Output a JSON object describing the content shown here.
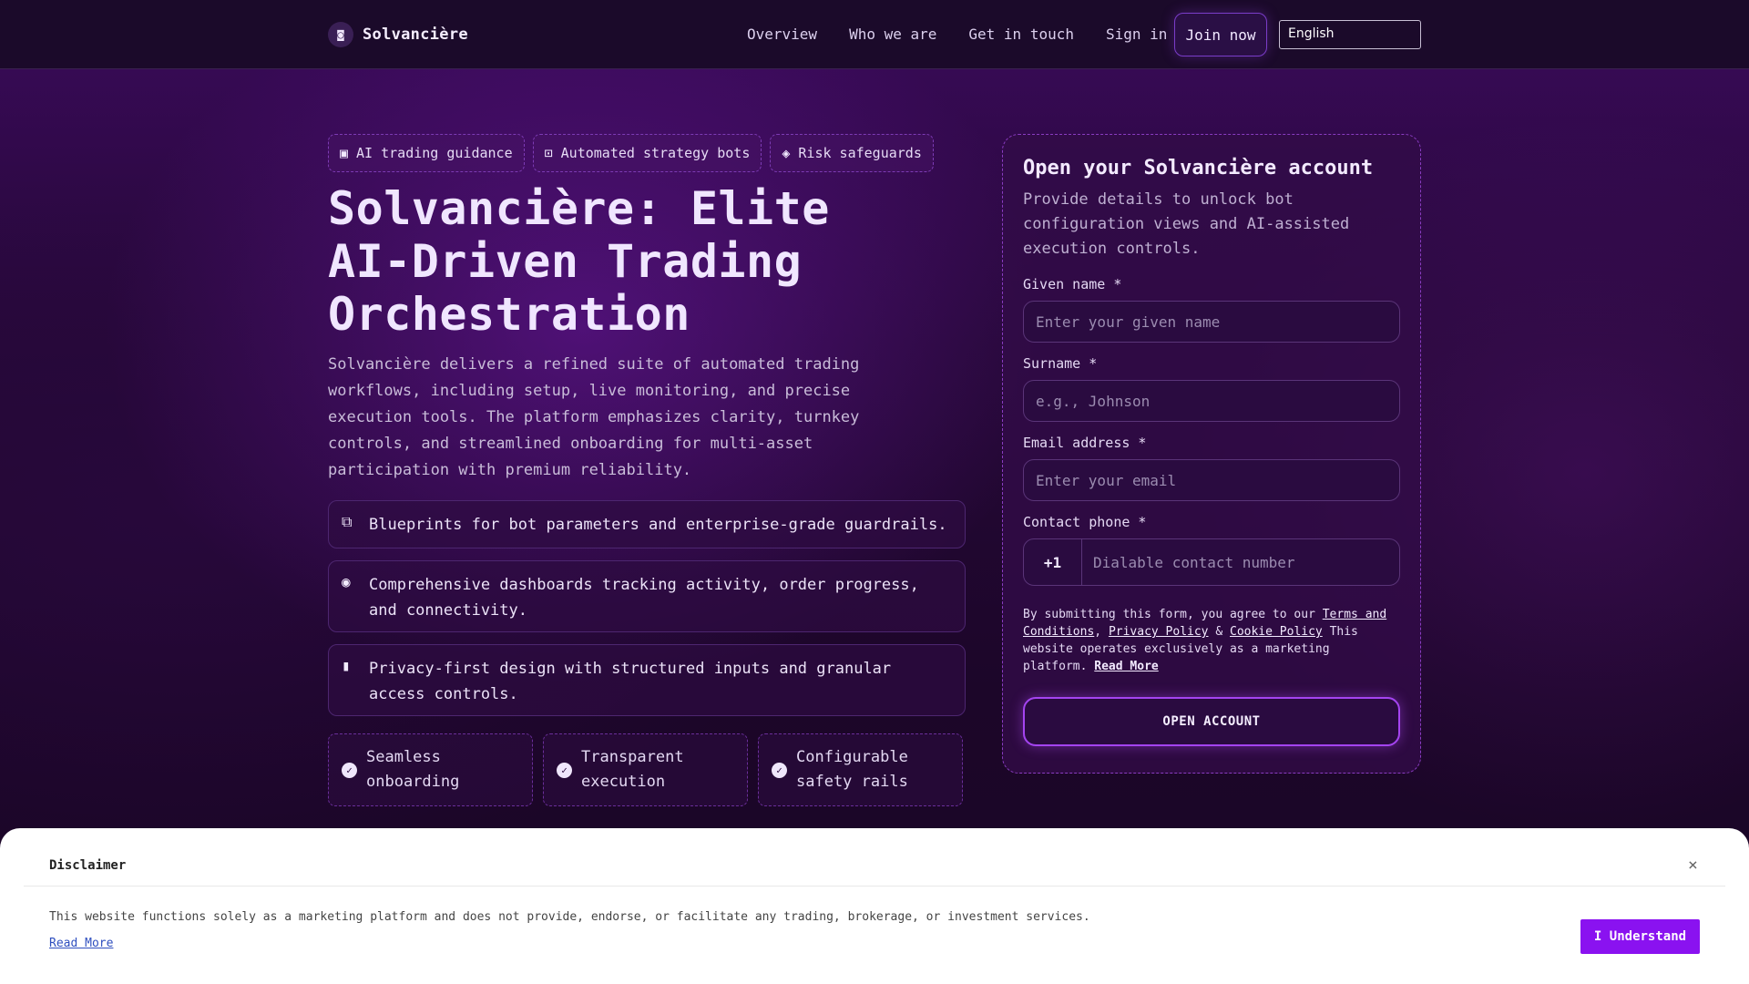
{
  "header": {
    "brand_mark": "◙",
    "brand_name": "Solvancière",
    "nav": [
      "Overview",
      "Who we are",
      "Get in touch",
      "Sign in"
    ],
    "join_label": "Join now",
    "language": "English"
  },
  "hero": {
    "chips": [
      {
        "icon": "microchip-icon",
        "label": "AI trading guidance"
      },
      {
        "icon": "robot-icon",
        "label": "Automated strategy bots"
      },
      {
        "icon": "shield-icon",
        "label": "Risk safeguards"
      }
    ],
    "title": "Solvancière: Elite AI-Driven Trading Orchestration",
    "description": "Solvancière delivers a refined suite of automated trading workflows, including setup, live monitoring, and precise execution tools. The platform emphasizes clarity, turnkey controls, and streamlined onboarding for multi-asset participation with premium reliability.",
    "features": [
      {
        "icon": "network-icon",
        "text": "Blueprints for bot parameters and enterprise-grade guardrails."
      },
      {
        "icon": "dashboard-icon",
        "text": "Comprehensive dashboards tracking activity, order progress, and connectivity."
      },
      {
        "icon": "lock-icon",
        "text": "Privacy-first design with structured inputs and granular access controls."
      }
    ],
    "highlights": [
      "Seamless onboarding",
      "Transparent execution",
      "Configurable safety rails"
    ]
  },
  "form": {
    "title": "Open your Solvancière account",
    "subtitle": "Provide details to unlock bot configuration views and AI-assisted execution controls.",
    "given_name_label": "Given name *",
    "given_name_placeholder": "Enter your given name",
    "surname_label": "Surname *",
    "surname_placeholder": "e.g., Johnson",
    "email_label": "Email address *",
    "email_placeholder": "Enter your email",
    "phone_label": "Contact phone *",
    "phone_code": "+1",
    "phone_placeholder": "Dialable contact number",
    "consent_prefix": "By submitting this form, you agree to our",
    "terms_link": "Terms and Conditions",
    "comma": ",",
    "privacy_link": "Privacy Policy",
    "amp": "&",
    "cookie_link": "Cookie Policy",
    "consent_suffix": "This website operates exclusively as a marketing platform.",
    "read_more": "Read More",
    "submit_label": "OPEN ACCOUNT"
  },
  "disclaimer": {
    "title": "Disclaimer",
    "close": "×",
    "text": "This website functions solely as a marketing platform and does not provide, endorse, or facilitate any trading, brokerage, or investment services.",
    "read_more": "Read More",
    "button": "I Understand"
  },
  "colors": {
    "accent": "#8a12f0",
    "border": "#8a3cc2",
    "background": "#1a0626"
  }
}
